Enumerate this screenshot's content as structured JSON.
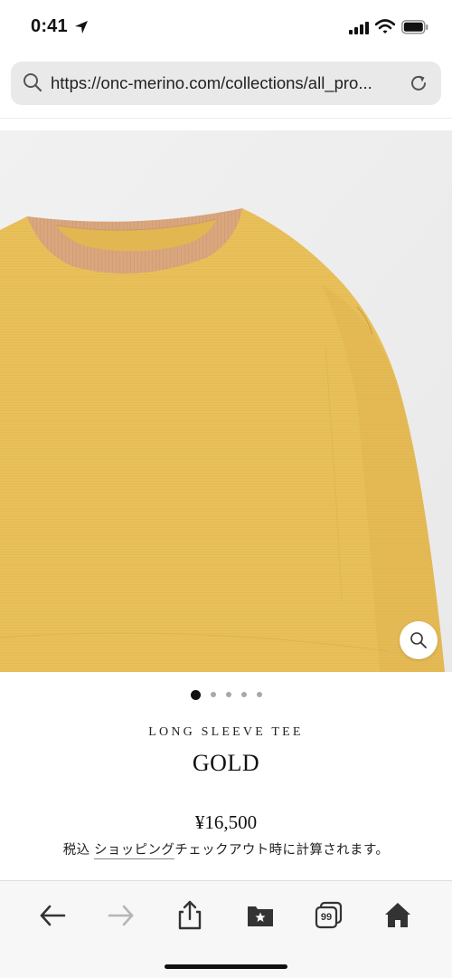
{
  "status_bar": {
    "time": "0:41"
  },
  "browser": {
    "url": "https://onc-merino.com/collections/all_pro..."
  },
  "product": {
    "subtitle": "LONG SLEEVE TEE",
    "title": "GOLD",
    "price": "¥16,500",
    "tax_prefix": "税込 ",
    "shipping_link": "ショッピング",
    "tax_suffix": "チェックアウト時に計算されます。",
    "image_count": 5,
    "active_image_index": 0
  },
  "toolbar": {
    "tab_count": "99",
    "icons": [
      "back-arrow-icon",
      "forward-arrow-icon",
      "share-icon",
      "bookmarks-icon",
      "tabs-icon",
      "home-icon"
    ]
  },
  "colors": {
    "shirt": "#e8c05a",
    "collar": "#d9a67e",
    "url_bar": "#e9e9ea",
    "forward_disabled": "#b5b5b5"
  }
}
